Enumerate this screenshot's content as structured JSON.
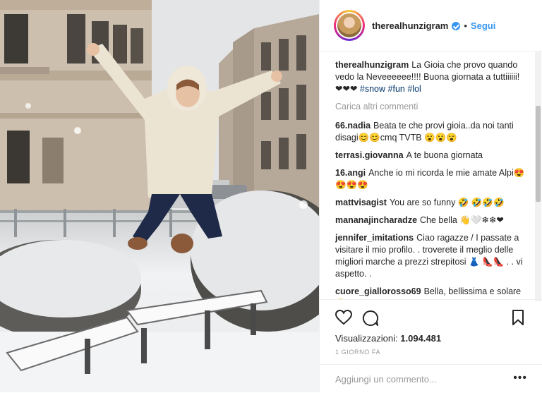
{
  "post": {
    "username": "therealhunzigram",
    "follow_label": "Segui",
    "separator": "•",
    "caption": {
      "username": "therealhunzigram",
      "text": "La Gioia che provo quando vedo la Neveeeeee!!!! Buona giornata a tuttiiiiii! ❤❤❤",
      "hashtags": [
        "#snow",
        "#fun",
        "#lol"
      ]
    },
    "load_more_label": "Carica altri commenti",
    "comments": [
      {
        "username": "66.nadia",
        "text": "Beata te che provi gioia..da noi tanti disagi😊😊cmq TVTB 😮😮😮"
      },
      {
        "username": "terrasi.giovanna",
        "text": "A te buona giornata"
      },
      {
        "username": "16.angi",
        "text": "Anche io mi ricorda le mie amate Alpi😍😍😍😍"
      },
      {
        "username": "mattvisagist",
        "text": "You are so funny 🤣 🤣🤣🤣"
      },
      {
        "username": "mananajincharadze",
        "text": "Che bella 👋🤍❄❄❤"
      },
      {
        "username": "jennifer_imitations",
        "text": "Ciao ragazze / I passate a visitare il mio profilo. . troverete il meglio delle migliori marche a prezzi strepitosi 👗 👠👠 . . vi aspetto. ."
      },
      {
        "username": "cuore_giallorosso69",
        "text": "Bella, bellissima e solare 😊"
      }
    ],
    "views_label": "Visualizzazioni:",
    "views_count": "1.094.481",
    "date_label": "1 GIORNO FA",
    "add_comment_placeholder": "Aggiungi un commento...",
    "more_label": "•••"
  },
  "icons": [
    "heart-icon",
    "comment-icon",
    "bookmark-icon",
    "verified-icon"
  ],
  "colors": {
    "link": "#3897f0",
    "hashtag": "#003569",
    "muted": "#999999",
    "text": "#262626",
    "border": "#efefef"
  }
}
